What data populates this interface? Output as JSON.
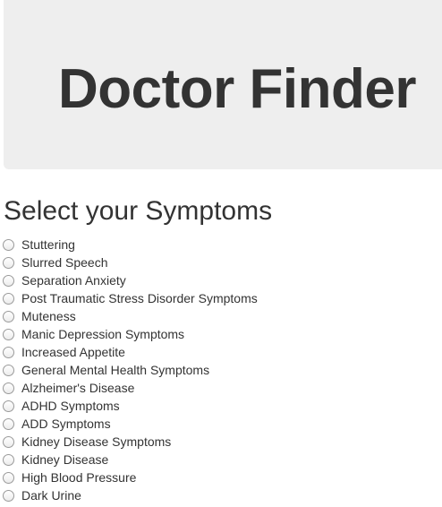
{
  "header": {
    "title": "Doctor Finder"
  },
  "main": {
    "heading": "Select your Symptoms",
    "symptoms": [
      {
        "label": "Stuttering",
        "selected": false
      },
      {
        "label": "Slurred Speech",
        "selected": false
      },
      {
        "label": "Separation Anxiety",
        "selected": false
      },
      {
        "label": "Post Traumatic Stress Disorder Symptoms",
        "selected": false
      },
      {
        "label": "Muteness",
        "selected": false
      },
      {
        "label": "Manic Depression Symptoms",
        "selected": false
      },
      {
        "label": "Increased Appetite",
        "selected": false
      },
      {
        "label": "General Mental Health Symptoms",
        "selected": false
      },
      {
        "label": "Alzheimer's Disease",
        "selected": false
      },
      {
        "label": "ADHD Symptoms",
        "selected": false
      },
      {
        "label": "ADD Symptoms",
        "selected": false
      },
      {
        "label": "Kidney Disease Symptoms",
        "selected": false
      },
      {
        "label": "Kidney Disease",
        "selected": false
      },
      {
        "label": "High Blood Pressure",
        "selected": false
      },
      {
        "label": "Dark Urine",
        "selected": false
      }
    ]
  },
  "colors": {
    "jumbotron_bg": "#eeeeee",
    "text": "#333333",
    "radio_border": "#9a9a9a"
  }
}
